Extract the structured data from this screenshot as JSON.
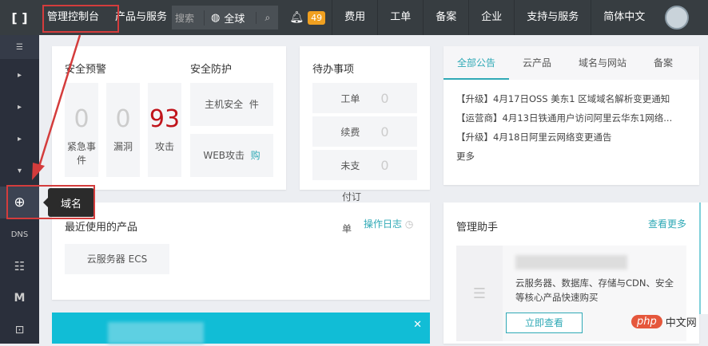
{
  "topbar": {
    "logo": "[ ]",
    "console": "管理控制台",
    "products": "产品与服务",
    "search_placeholder": "搜索",
    "region": "全球",
    "notification_count": "49",
    "nav": [
      "费用",
      "工单",
      "备案",
      "企业",
      "支持与服务",
      "简体中文"
    ]
  },
  "sidebar": {
    "tooltip": "域名"
  },
  "security": {
    "title": "安全预警",
    "stats": [
      {
        "value": "0",
        "label": "紧急事件"
      },
      {
        "value": "0",
        "label": "漏洞"
      },
      {
        "value": "93",
        "label": "攻击"
      }
    ],
    "protection_title": "安全防护",
    "protection": [
      {
        "label": "主机安全",
        "extra": "件"
      },
      {
        "label": "WEB攻击",
        "extra": "购"
      }
    ]
  },
  "todo": {
    "title": "待办事项",
    "items": [
      {
        "label": "工单",
        "value": "0"
      },
      {
        "label": "续费",
        "value": "0"
      },
      {
        "label": "未支",
        "value": "0"
      }
    ],
    "overflow_1": "付订",
    "overflow_2": "单"
  },
  "announcements": {
    "tabs": [
      "全部公告",
      "云产品",
      "域名与网站",
      "备案"
    ],
    "items": [
      "【升级】4月17日OSS 美东1 区域域名解析变更通知",
      "【运营商】4月13日铁通用户访问阿里云华东1网络...",
      "【升级】4月18日阿里云网络变更通告"
    ],
    "more": "更多"
  },
  "recent": {
    "title": "最近使用的产品",
    "log_link": "操作日志",
    "products": [
      "云服务器 ECS"
    ]
  },
  "assistant": {
    "title": "管理助手",
    "more": "查看更多",
    "desc": "云服务器、数据库、存储与CDN、安全等核心产品快速购买",
    "button": "立即查看"
  },
  "watermark": {
    "brand": "php",
    "text": "中文网"
  },
  "colors": {
    "accent": "#2fa9b6",
    "alert": "#c0141b",
    "topbar": "#373d41",
    "annotation": "#d43c3c"
  }
}
